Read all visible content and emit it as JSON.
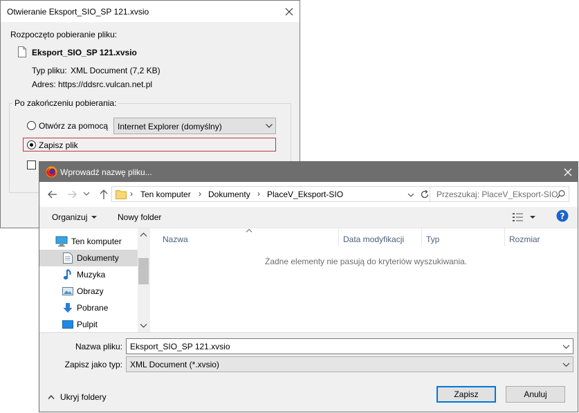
{
  "download_dialog": {
    "title": "Otwieranie Eksport_SIO_SP 121.xvsio",
    "started_text": "Rozpoczęto pobieranie pliku:",
    "filename": "Eksport_SIO_SP 121.xvsio",
    "type_label": "Typ pliku:",
    "type_value": "XML Document (7,2 KB)",
    "address_label": "Adres:",
    "address_value": "https://ddsrc.vulcan.net.pl",
    "group_label": "Po zakończeniu pobierania:",
    "open_with_label": "Otwórz za pomocą",
    "open_with_selected": "Internet Explorer (domyślny)",
    "save_label": "Zapisz plik",
    "selected_option": "save"
  },
  "save_dialog": {
    "title": "Wprowadź nazwę pliku...",
    "breadcrumbs": [
      "Ten komputer",
      "Dokumenty",
      "PlaceV_Eksport-SIO"
    ],
    "search_placeholder": "Przeszukaj: PlaceV_Eksport-SIO",
    "toolbar": {
      "organize": "Organizuj",
      "new_folder": "Nowy folder"
    },
    "nav_items": [
      {
        "label": "Ten komputer",
        "icon": "computer-icon",
        "selected": false
      },
      {
        "label": "Dokumenty",
        "icon": "documents-icon",
        "selected": true
      },
      {
        "label": "Muzyka",
        "icon": "music-icon",
        "selected": false
      },
      {
        "label": "Obrazy",
        "icon": "pictures-icon",
        "selected": false
      },
      {
        "label": "Pobrane",
        "icon": "downloads-icon",
        "selected": false
      },
      {
        "label": "Pulpit",
        "icon": "desktop-icon",
        "selected": false
      }
    ],
    "columns": [
      "Nazwa",
      "Data modyfikacji",
      "Typ",
      "Rozmiar"
    ],
    "empty_message": "Żadne elementy nie pasują do kryteriów wyszukiwania.",
    "filename_label": "Nazwa pliku:",
    "filename_value": "Eksport_SIO_SP 121.xvsio",
    "filetype_label": "Zapisz jako typ:",
    "filetype_value": "XML Document (*.xvsio)",
    "hide_folders": "Ukryj foldery",
    "save_button": "Zapisz",
    "cancel_button": "Anuluj"
  },
  "colors": {
    "accent": "#0078d7",
    "focus_frame": "#c8303a",
    "titlebar_inactive": "#6e6e6e",
    "column_header_text": "#4c607a"
  }
}
